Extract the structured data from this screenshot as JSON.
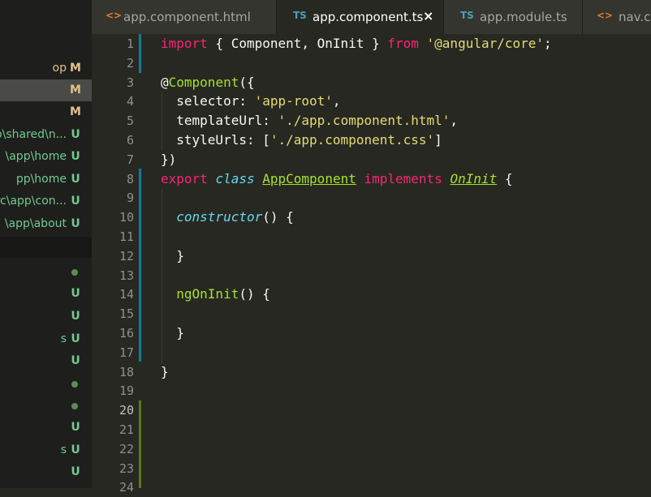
{
  "tabs": [
    {
      "icon": "<>",
      "icon_color": "#e37933",
      "label": "app.component.html",
      "active": false
    },
    {
      "icon": "TS",
      "icon_color": "#519aba",
      "label": "app.component.ts",
      "active": true,
      "close": "×"
    },
    {
      "icon": "TS",
      "icon_color": "#519aba",
      "label": "app.module.ts",
      "active": false
    },
    {
      "icon": "<>",
      "icon_color": "#e37933",
      "label": "nav.co",
      "active": false
    }
  ],
  "sidebar": {
    "items": [
      {
        "label": "op",
        "status": "M"
      },
      {
        "label": "",
        "status": "M",
        "selected": true
      },
      {
        "label": "",
        "status": "M"
      },
      {
        "label": "op\\shared\\n...",
        "status": "U"
      },
      {
        "label": "\\app\\home",
        "status": "U"
      },
      {
        "label": "pp\\home",
        "status": "U"
      },
      {
        "label": "rc\\app\\con...",
        "status": "U"
      },
      {
        "label": "\\app\\about",
        "status": "U"
      }
    ],
    "items2": [
      {
        "label": "",
        "status": "dot"
      },
      {
        "label": "",
        "status": "U"
      },
      {
        "label": "",
        "status": "U"
      },
      {
        "label": "s",
        "status": "U"
      },
      {
        "label": "",
        "status": "U"
      },
      {
        "label": "",
        "status": "dot"
      },
      {
        "label": "",
        "status": "dot"
      },
      {
        "label": "",
        "status": "U"
      },
      {
        "label": "s",
        "status": "U"
      },
      {
        "label": "",
        "status": "U"
      }
    ]
  },
  "editor": {
    "line_numbers": [
      "1",
      "2",
      "3",
      "4",
      "5",
      "6",
      "7",
      "8",
      "9",
      "10",
      "11",
      "12",
      "13",
      "14",
      "15",
      "16",
      "17",
      "18",
      "19",
      "20",
      "21",
      "22",
      "23",
      "24"
    ],
    "current_line": "20",
    "lines": [
      [
        {
          "t": "import",
          "c": "kw"
        },
        {
          "t": " { Component, OnInit } ",
          "c": "p"
        },
        {
          "t": "from",
          "c": "kw"
        },
        {
          "t": " ",
          "c": "p"
        },
        {
          "t": "'@angular/core'",
          "c": "str"
        },
        {
          "t": ";",
          "c": "p"
        }
      ],
      [],
      [
        {
          "t": "@",
          "c": "p"
        },
        {
          "t": "Component",
          "c": "fn"
        },
        {
          "t": "({",
          "c": "p"
        }
      ],
      [
        {
          "t": "  selector: ",
          "c": "p"
        },
        {
          "t": "'app-root'",
          "c": "str"
        },
        {
          "t": ",",
          "c": "p"
        }
      ],
      [
        {
          "t": "  templateUrl: ",
          "c": "p"
        },
        {
          "t": "'./app.component.html'",
          "c": "str"
        },
        {
          "t": ",",
          "c": "p"
        }
      ],
      [
        {
          "t": "  styleUrls: [",
          "c": "p"
        },
        {
          "t": "'./app.component.css'",
          "c": "str"
        },
        {
          "t": "]",
          "c": "p"
        }
      ],
      [
        {
          "t": "})",
          "c": "p"
        }
      ],
      [
        {
          "t": "export",
          "c": "kw"
        },
        {
          "t": " ",
          "c": "p"
        },
        {
          "t": "class",
          "c": "st"
        },
        {
          "t": " ",
          "c": "p"
        },
        {
          "t": "AppComponent",
          "c": "cls"
        },
        {
          "t": " ",
          "c": "p"
        },
        {
          "t": "implements",
          "c": "kw"
        },
        {
          "t": " ",
          "c": "p"
        },
        {
          "t": "OnInit",
          "c": "inh"
        },
        {
          "t": " {",
          "c": "p"
        }
      ],
      [],
      [
        {
          "t": "  ",
          "c": "p"
        },
        {
          "t": "constructor",
          "c": "ctor"
        },
        {
          "t": "() {",
          "c": "p"
        }
      ],
      [],
      [
        {
          "t": "  }",
          "c": "p"
        }
      ],
      [],
      [
        {
          "t": "  ",
          "c": "p"
        },
        {
          "t": "ngOnInit",
          "c": "fn"
        },
        {
          "t": "() {",
          "c": "p"
        }
      ],
      [],
      [
        {
          "t": "  }",
          "c": "p"
        }
      ],
      [],
      [
        {
          "t": "}",
          "c": "p"
        }
      ],
      [],
      [],
      [],
      [],
      [],
      []
    ]
  },
  "colors": {
    "kw": "#f92672",
    "str": "#e6db74",
    "fn": "#a6e22e",
    "st": "#66d9ef",
    "p": "#f8f8f2",
    "modified": "#e2c08d",
    "untracked": "#73c991",
    "gutter_modified": "#0c7d9d",
    "gutter_added": "#587c0c"
  }
}
